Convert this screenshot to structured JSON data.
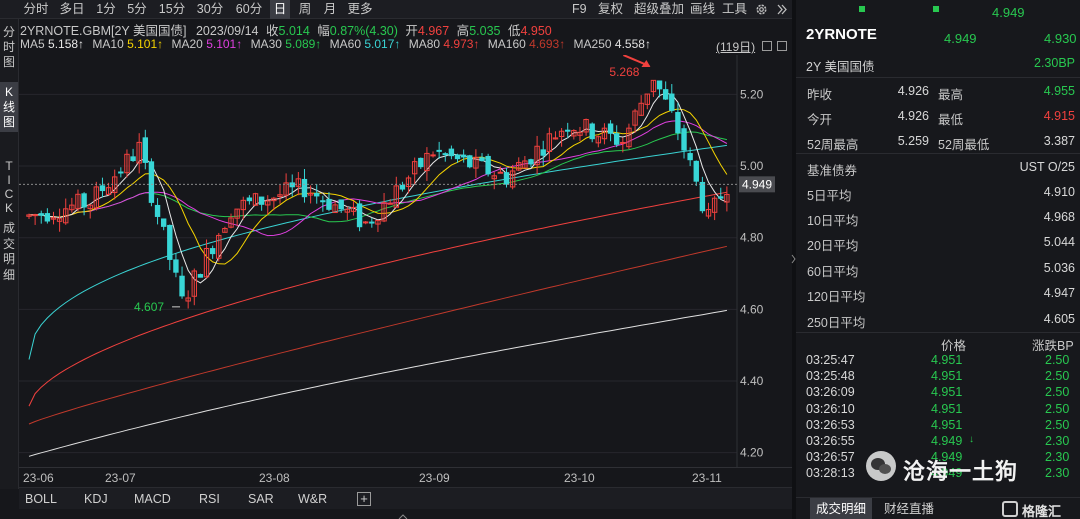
{
  "period_tabs": [
    "分时",
    "多日",
    "1分",
    "5分",
    "15分",
    "30分",
    "60分",
    "日",
    "周",
    "月",
    "更多"
  ],
  "active_period": "日",
  "menu_items": [
    "F9",
    "复权",
    "超级叠加",
    "画线",
    "工具"
  ],
  "left_tabs": {
    "fenshi": "分时图",
    "kline": "K线图",
    "tick": "TICK",
    "detail": "成交明细"
  },
  "info": {
    "symbol": "2YRNOTE.GBM[2Y 美国国债]",
    "date": "2023/09/14",
    "close_label": "收",
    "close": "5.014",
    "change_label": "幅",
    "change": "0.87%(4.30)",
    "open_label": "开",
    "open": "4.967",
    "high_label": "高",
    "high": "5.035",
    "low_label": "低",
    "low": "4.950"
  },
  "ma": [
    {
      "label": "MA5",
      "value": "5.158↑",
      "color": "#e8e8e8"
    },
    {
      "label": "MA10",
      "value": "5.101↑",
      "color": "#f5d400"
    },
    {
      "label": "MA20",
      "value": "5.101↑",
      "color": "#e040e0"
    },
    {
      "label": "MA30",
      "value": "5.089↑",
      "color": "#28c850"
    },
    {
      "label": "MA60",
      "value": "5.017↑",
      "color": "#3ad3d3"
    },
    {
      "label": "MA80",
      "value": "4.973↑",
      "color": "#f0413e"
    },
    {
      "label": "MA160",
      "value": "4.693↑",
      "color": "#c0392b"
    },
    {
      "label": "MA250",
      "value": "4.558↑",
      "color": "#e0e0e0"
    }
  ],
  "range_label": "(119日)",
  "y_ticks": [
    "5.20",
    "5.00",
    "4.80",
    "4.60",
    "4.40",
    "4.20"
  ],
  "date_ticks": [
    "23-06",
    "23-07",
    "23-08",
    "23-09",
    "23-10",
    "23-11"
  ],
  "current_price": "4.949",
  "annot_high": "5.268",
  "annot_low": "4.607",
  "indicator_tabs": [
    "BOLL",
    "KDJ",
    "MACD",
    "RSI",
    "SAR",
    "W&R"
  ],
  "add_tab": "+",
  "quote": {
    "top_price": "4.949",
    "name": "2YRNOTE",
    "subname": "2Y 美国国债",
    "price": "4.949",
    "price2": "4.930",
    "change_bp": "2.30BP"
  },
  "stats": [
    {
      "l1": "昨收",
      "v1": "4.926",
      "c1": "#d8d8d8",
      "l2": "最高",
      "v2": "4.955",
      "c2": "#28c850"
    },
    {
      "l1": "今开",
      "v1": "4.926",
      "c1": "#d8d8d8",
      "l2": "最低",
      "v2": "4.915",
      "c2": "#f0413e"
    },
    {
      "l1": "52周最高",
      "v1": "5.259",
      "c1": "#d8d8d8",
      "l2": "52周最低",
      "v2": "3.387",
      "c2": "#d8d8d8"
    }
  ],
  "benchmark": {
    "label": "基准债券",
    "value": "UST O/25"
  },
  "averages": [
    {
      "label": "5日平均",
      "value": "4.910"
    },
    {
      "label": "10日平均",
      "value": "4.968"
    },
    {
      "label": "20日平均",
      "value": "5.044"
    },
    {
      "label": "60日平均",
      "value": "5.036"
    },
    {
      "label": "120日平均",
      "value": "4.947"
    },
    {
      "label": "250日平均",
      "value": "4.605"
    }
  ],
  "trades_header": {
    "price": "价格",
    "bp": "涨跌BP"
  },
  "trades": [
    {
      "time": "03:25:47",
      "price": "4.951",
      "bp": "2.50",
      "mark": ""
    },
    {
      "time": "03:25:48",
      "price": "4.951",
      "bp": "2.50",
      "mark": ""
    },
    {
      "time": "03:26:09",
      "price": "4.951",
      "bp": "2.50",
      "mark": ""
    },
    {
      "time": "03:26:10",
      "price": "4.951",
      "bp": "2.50",
      "mark": ""
    },
    {
      "time": "03:26:53",
      "price": "4.951",
      "bp": "2.50",
      "mark": ""
    },
    {
      "time": "03:26:55",
      "price": "4.949",
      "bp": "2.30",
      "mark": "↓"
    },
    {
      "time": "03:26:57",
      "price": "4.949",
      "bp": "2.30",
      "mark": ""
    },
    {
      "time": "03:28:13",
      "price": "4.949",
      "bp": "2.30",
      "mark": ""
    }
  ],
  "right_tabs": [
    "成交明细",
    "财经直播"
  ],
  "watermark": "沧海一土狗",
  "logo_text": "格隆汇"
}
